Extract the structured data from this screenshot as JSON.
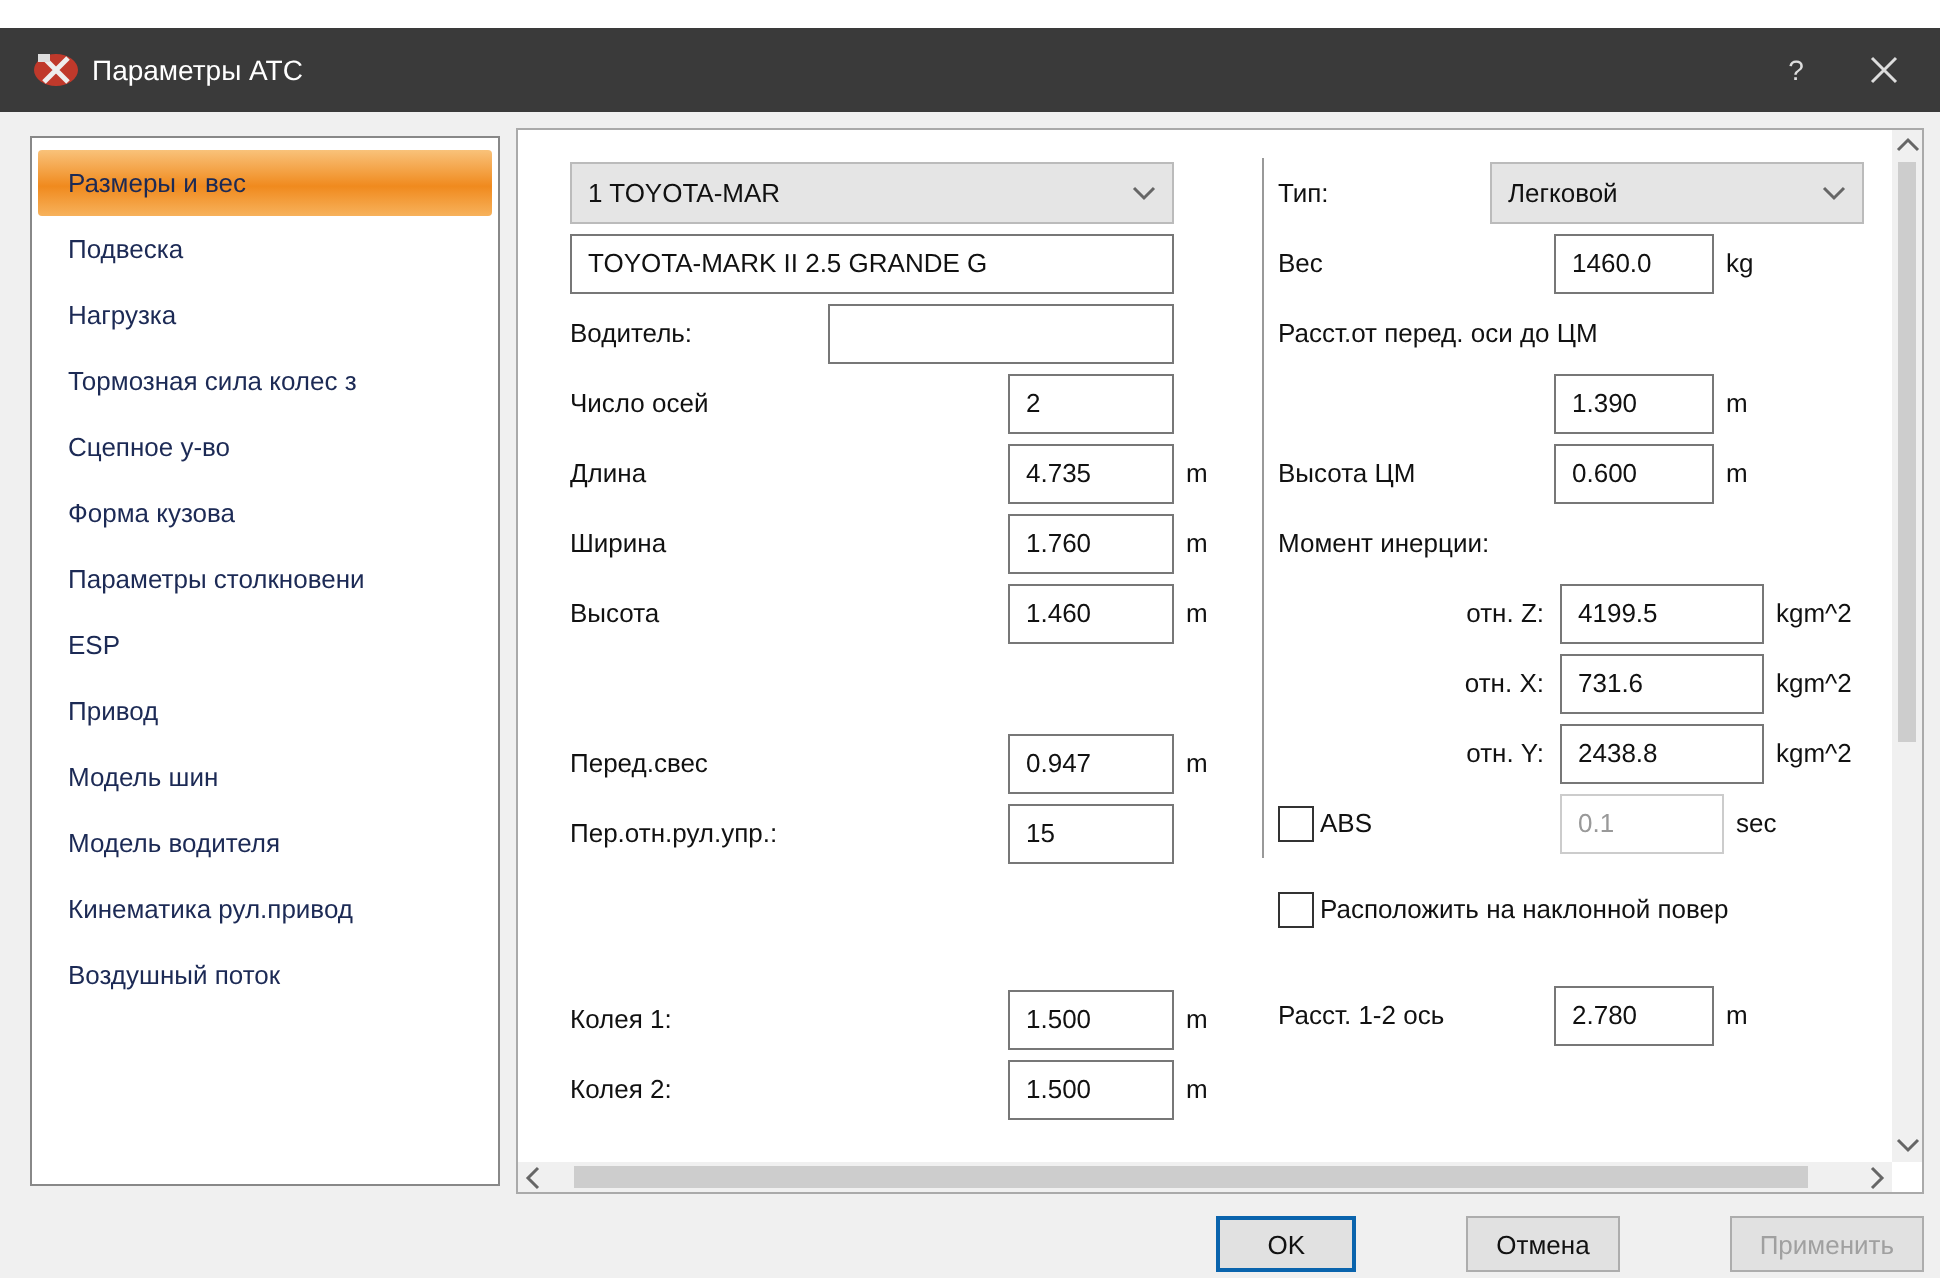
{
  "window": {
    "title": "Параметры АТС",
    "help": "?"
  },
  "sidebar": {
    "items": [
      {
        "label": "Размеры и вес",
        "selected": true
      },
      {
        "label": "Подвеска",
        "selected": false
      },
      {
        "label": "Нагрузка",
        "selected": false
      },
      {
        "label": "Тормозная сила колес з",
        "selected": false
      },
      {
        "label": "Сцепное у-во",
        "selected": false
      },
      {
        "label": "Форма кузова",
        "selected": false
      },
      {
        "label": "Параметры столкновени",
        "selected": false
      },
      {
        "label": "ESP",
        "selected": false
      },
      {
        "label": "Привод",
        "selected": false
      },
      {
        "label": "Модель шин",
        "selected": false
      },
      {
        "label": "Модель водителя",
        "selected": false
      },
      {
        "label": "Кинематика рул.привод",
        "selected": false
      },
      {
        "label": "Воздушный поток",
        "selected": false
      }
    ]
  },
  "left_groups": [
    [
      {
        "kind": "combo",
        "value": "1  TOYOTA-MAR"
      },
      {
        "kind": "text",
        "value": "TOYOTA-MARK II 2.5 GRANDE G"
      },
      {
        "kind": "wide",
        "label": "Водитель:"
      },
      {
        "kind": "field",
        "label": "Число осей",
        "value": "2"
      },
      {
        "kind": "field",
        "label": "Длина",
        "value": "4.735",
        "unit": "m"
      },
      {
        "kind": "field",
        "label": "Ширина",
        "value": "1.760",
        "unit": "m"
      },
      {
        "kind": "field",
        "label": "Высота",
        "value": "1.460",
        "unit": "m"
      }
    ],
    [
      {
        "kind": "field",
        "label": "Перед.свес",
        "value": "0.947",
        "unit": "m"
      },
      {
        "kind": "field",
        "label": "Пер.отн.рул.упр.:",
        "value": "15"
      }
    ],
    [
      {
        "kind": "field",
        "label": "Колея 1:",
        "value": "1.500",
        "unit": "m"
      },
      {
        "kind": "field",
        "label": "Колея 2:",
        "value": "1.500",
        "unit": "m"
      }
    ]
  ],
  "right_groups": [
    [
      {
        "kind": "combo",
        "label": "Тип:",
        "value": "Легковой"
      },
      {
        "kind": "field",
        "label": "Вес",
        "value": "1460.0",
        "unit": "kg"
      },
      {
        "kind": "label",
        "label": "Расст.от перед. оси до ЦМ"
      },
      {
        "kind": "field",
        "value": "1.390",
        "unit": "m"
      },
      {
        "kind": "field",
        "label": "Высота ЦМ",
        "value": "0.600",
        "unit": "m"
      },
      {
        "kind": "label",
        "label": "Момент инерции:"
      },
      {
        "kind": "indent",
        "label": "отн. Z:",
        "value": "4199.5",
        "unit": "kgm^2"
      },
      {
        "kind": "indent",
        "label": "отн. X:",
        "value": "731.6",
        "unit": "kgm^2"
      },
      {
        "kind": "indent",
        "label": "отн. Y:",
        "value": "2438.8",
        "unit": "kgm^2"
      },
      {
        "kind": "check_field",
        "label": "ABS",
        "checked": false,
        "value": "0.1",
        "disabled": true,
        "unit": "sec"
      }
    ],
    [
      {
        "kind": "checkbox",
        "label": "Расположить на наклонной повер",
        "checked": false
      }
    ],
    [
      {
        "kind": "field",
        "label": "Расст. 1-2 ось",
        "value": "2.780",
        "unit": "m"
      }
    ]
  ],
  "buttons": [
    {
      "label": "OK",
      "default": true,
      "disabled": false
    },
    {
      "label": "Отмена",
      "default": false,
      "disabled": false
    },
    {
      "label": "Применить",
      "default": false,
      "disabled": true
    }
  ]
}
